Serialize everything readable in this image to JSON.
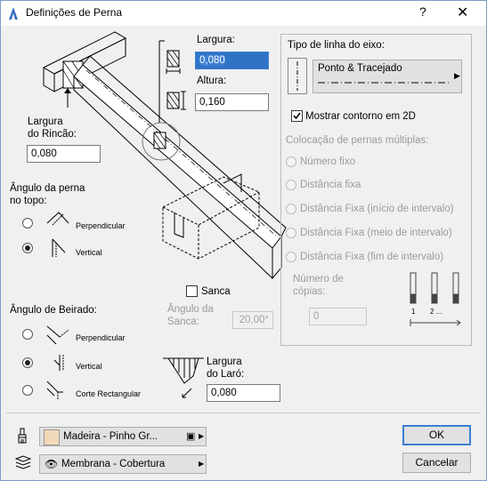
{
  "window": {
    "title": "Definições de Perna",
    "help": "?",
    "close": "✕"
  },
  "left": {
    "largura_rincao_label": "Largura\ndo Rincão:",
    "largura_rincao_value": "0,080",
    "angulo_perna_label": "Ângulo da perna\nno topo:",
    "perna_opt1": "Perpendicular",
    "perna_opt2": "Vertical",
    "angulo_beirado_label": "Ângulo de Beirado:",
    "beirado_opt1": "Perpendicular",
    "beirado_opt2": "Vertical",
    "beirado_opt3": "Corte Rectangular"
  },
  "center": {
    "largura_label": "Largura:",
    "largura_value": "0,080",
    "altura_label": "Altura:",
    "altura_value": "0,160",
    "sanca_label": "Sanca",
    "angulo_sanca_label": "Ângulo da\nSanca:",
    "angulo_sanca_value": "20,00°",
    "largura_laro_label": "Largura\ndo Laró:",
    "largura_laro_value": "0,080"
  },
  "right": {
    "tipo_linha_label": "Tipo de linha do eixo:",
    "tipo_linha_value": "Ponto & Tracejado",
    "mostrar_contorno_label": "Mostrar contorno em 2D",
    "colocacao_label": "Colocação de pernas múltiplas:",
    "opts": [
      "Número fixo",
      "Distância fixa",
      "Distância Fixa (início de intervalo)",
      "Distância Fixa (meio de intervalo)",
      "Distância Fixa (fim de intervalo)"
    ],
    "numero_copias_label": "Número de\ncópias:",
    "numero_copias_value": "0",
    "count_label1": "1",
    "count_label2": "2 ..."
  },
  "bottom": {
    "material_value": "Madeira - Pinho Gr...",
    "material_color": "#f2d9b9",
    "membrana_value": "Membrana - Cobertura",
    "ok": "OK",
    "cancel": "Cancelar"
  }
}
